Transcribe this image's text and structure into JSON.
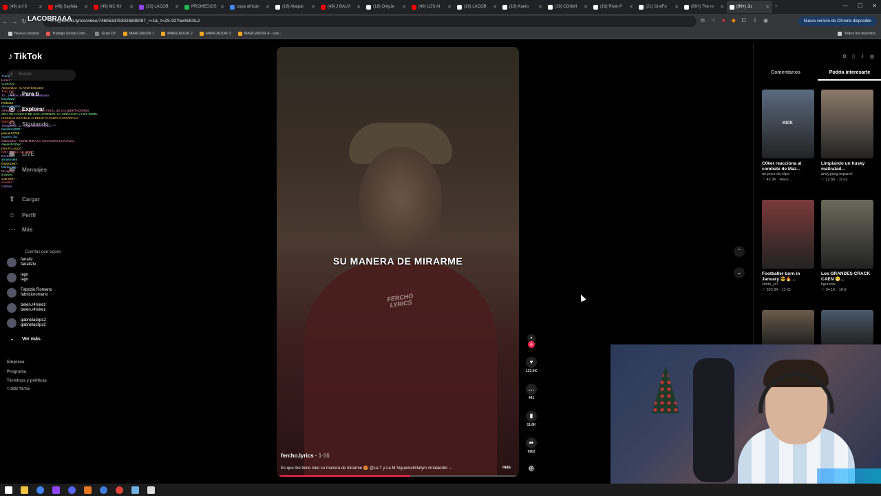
{
  "browser": {
    "tabs": [
      {
        "label": "(49) á ∂ lí",
        "color": "#ff0000"
      },
      {
        "label": "(49) Sayfala",
        "color": "#ff0000"
      },
      {
        "label": "(49) MC Kir",
        "color": "#ff0000"
      },
      {
        "label": "(33) LACOB",
        "color": "#9146ff"
      },
      {
        "label": "PROMEDIOS",
        "color": "#1db954"
      },
      {
        "label": "copa african",
        "color": "#4285f4"
      },
      {
        "label": "(18) Ataque",
        "color": "#fff"
      },
      {
        "label": "(49) J BALVI",
        "color": "#ff0000"
      },
      {
        "label": "(18) OnlyJe",
        "color": "#fff"
      },
      {
        "label": "(49) LOS AI",
        "color": "#ff0000"
      },
      {
        "label": "(19) LACOB",
        "color": "#fff"
      },
      {
        "label": "(19) Kaeto",
        "color": "#fff"
      },
      {
        "label": "(19) CONMI",
        "color": "#fff"
      },
      {
        "label": "(19) River P",
        "color": "#fff"
      },
      {
        "label": "(21) OneFo",
        "color": "#fff"
      },
      {
        "label": "(99+) The m",
        "color": "#fff"
      },
      {
        "label": "(99+) Ju",
        "color": "#fff",
        "active": true
      }
    ],
    "overlay_name": "LACOBRAAA",
    "url_prefix": "om/",
    "url_main": "@fercho.lyrics/video/7460533753026839097_r=1&_t=ZS-92YawWlOIL2",
    "update_label": "Nueva versión de Chrome disponible",
    "bookmarks": [
      "Nueva carpeta",
      "Trabajo Social Com...",
      "Gran DT",
      "MARCADOR 1",
      "MARCADOR 2",
      "MARCADOR 3",
      "MARCADOR 4 - ove..."
    ],
    "bookmarks_all": "Todos los favoritos"
  },
  "sidebar": {
    "logo": "TikTok",
    "search_placeholder": "Buscar",
    "nav": [
      {
        "label": "Para ti",
        "icon": "home-icon"
      },
      {
        "label": "Explorar",
        "icon": "compass-icon"
      },
      {
        "label": "Siguiendo",
        "icon": "users-icon"
      },
      {
        "label": "LIVE",
        "icon": "live-icon"
      },
      {
        "label": "Mensajes",
        "icon": "message-icon"
      },
      {
        "label": "Cargar",
        "icon": "upload-icon"
      },
      {
        "label": "Perfil",
        "icon": "profile-icon"
      },
      {
        "label": "Más",
        "icon": "more-icon"
      }
    ],
    "following_title": "Cuentas que sigues",
    "following": [
      {
        "name": "fanatiz",
        "handle": "fanatiztv"
      },
      {
        "name": "lago",
        "handle": "lago"
      },
      {
        "name": "Fabrizio Romano",
        "handle": "fabrizioromano"
      },
      {
        "name": "belen.r4mirez",
        "handle": "belen.r4mirez"
      },
      {
        "name": "gabrielaclips2",
        "handle": "gabrielaclips2"
      }
    ],
    "see_more": "Ver más",
    "footer": [
      "Empresa",
      "Programa",
      "Términos y políticas",
      "© 2025 TikTok"
    ]
  },
  "chat": [
    "Jharol :",
    "ferdo1 :",
    "Cuyton33 :",
    "Alexpedl23 : ICARDI BOLUDO",
    "Tony tom :",
    "To _ a Sabe dina Les labbelalaaaa",
    "bocalayal :",
    "Pedro24 :",
    "derniipol4900 :",
    "AlPepito2 : CON RAZON EN LA FINAL DE LA LIBERTADORES",
    "2014 EN CANCHA DE SAN LORENZO, LA HINCHADA Y LOS SEMIL",
    "HINCHAS ESTABAN ALREIAE CUANDO CANTABA Ke",
    "labelcallb :",
    "ThiagoPolli_11 : QUE DICES FOCA ****",
    "hampton2002 :",
    "pesuar04758 :",
    "Agustin_lbs :",
    "mateus037 : NENE MIRA LA VOTACION JAJAJAJAJ",
    "Alejandro2hyd :",
    "pancho_arg10 :",
    "OM7_RIAL9_12_2000 :",
    "Ezedo :",
    "arrodondea :",
    "bryant1987 :",
    "Martin_arg :",
    "Nicogorg :",
    "imiloves :",
    "Juan0987 :",
    "leon967 :",
    "LatMae :"
  ],
  "video": {
    "lyric": "SU MANERA DE MIRARME",
    "watermark": "FERCHO LYRICS",
    "author": "fercho.lyrics",
    "date": "1-16",
    "description": "Es que me tiene loko su manera de mirarme 😍 @La T y La M Siguemell#latym #malandro ...",
    "more": "más",
    "progress": 0.55
  },
  "actions": {
    "likes": "123.4K",
    "comments": "441",
    "saves": "11.6K",
    "shares": "9902"
  },
  "right_panel": {
    "tabs": [
      "Comentarios",
      "Podría interesarte"
    ],
    "cards": [
      {
        "title": "C0ker reacciona al combate de Maz...",
        "author": "un.poco.de.clips",
        "likes": "43.3K",
        "date": "Hace...",
        "color": "#5a6a80",
        "thumb_text": "KICK"
      },
      {
        "title": "Limpiando un husky maltratad...",
        "author": "andy.jiang.espanol",
        "likes": "12.5K",
        "date": "11-11",
        "color": "#8a7a6a",
        "thumb_text": ""
      },
      {
        "title": "Footballer born in January 😎🔥...",
        "author": "shoto_yt7",
        "likes": "333.9K",
        "date": "11-11",
        "color": "#7a3a3a",
        "thumb_text": ""
      },
      {
        "title": "Los GRANDES CRACK CAEN 😬...",
        "author": "figurontv",
        "likes": "34.1K",
        "date": "10-9",
        "color": "#6a6a5a",
        "thumb_text": ""
      },
      {
        "title": "",
        "author": "",
        "likes": "",
        "date": "",
        "color": "#6a5a4a",
        "thumb_text": ""
      },
      {
        "title": "",
        "author": "",
        "likes": "",
        "date": "",
        "color": "#4a5a6a",
        "thumb_text": ""
      }
    ]
  }
}
